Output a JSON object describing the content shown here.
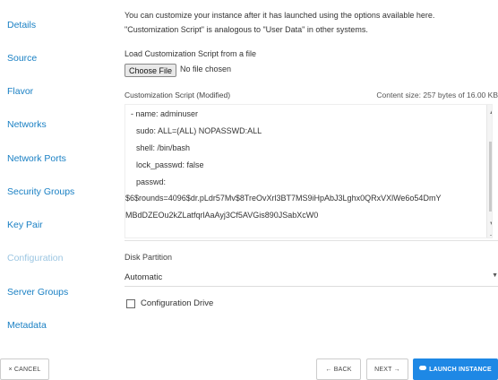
{
  "sidebar": {
    "items": [
      {
        "label": "Details"
      },
      {
        "label": "Source"
      },
      {
        "label": "Flavor"
      },
      {
        "label": "Networks"
      },
      {
        "label": "Network Ports"
      },
      {
        "label": "Security Groups"
      },
      {
        "label": "Key Pair"
      },
      {
        "label": "Configuration"
      },
      {
        "label": "Server Groups"
      },
      {
        "label": "Metadata"
      }
    ],
    "active": "Configuration"
  },
  "main": {
    "intro_line1": "You can customize your instance after it has launched using the options available here.",
    "intro_line2": "\"Customization Script\" is analogous to \"User Data\" in other systems.",
    "load_label": "Load Customization Script from a file",
    "choose_file_label": "Choose File",
    "no_file_text": "No file chosen",
    "script_label": "Customization Script (Modified)",
    "content_size": "Content size: 257 bytes of 16.00 KB",
    "script_lines": [
      "- name: adminuser",
      "sudo: ALL=(ALL) NOPASSWD:ALL",
      "shell: /bin/bash",
      "lock_passwd: false",
      "passwd:",
      "$6$rounds=4096$dr.pLdr57Mv$8TreOvXrl3BT7MS9iHpAbJ3Lghx0QRxVXlWe6o54DmY",
      "MBdDZEOu2kZLatfqrlAaAyj3Cf5AVGis890JSabXcW0"
    ],
    "disk_partition_label": "Disk Partition",
    "disk_partition_value": "Automatic",
    "config_drive_label": "Configuration Drive",
    "config_drive_checked": false
  },
  "footer": {
    "cancel": "× CANCEL",
    "back": "← BACK",
    "next": "NEXT →",
    "launch": "LAUNCH INSTANCE"
  },
  "colors": {
    "link": "#1a80c4",
    "active_link": "#9cc6e2",
    "primary": "#1e88e5"
  }
}
